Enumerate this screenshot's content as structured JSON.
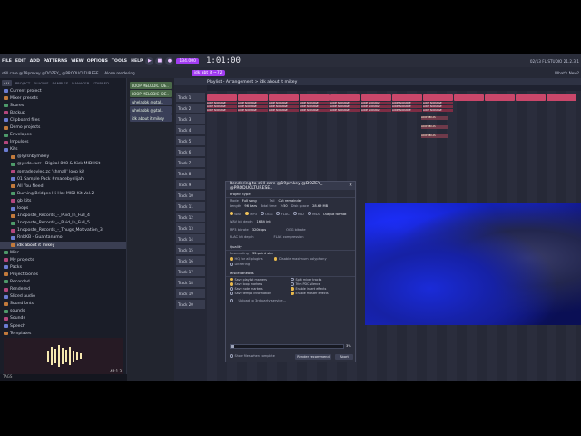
{
  "menu": [
    "FILE",
    "EDIT",
    "ADD",
    "PATTERNS",
    "VIEW",
    "OPTIONS",
    "TOOLS",
    "HELP"
  ],
  "transport": {
    "tempo": "134.000",
    "time": "1:01:00",
    "pattern": "idk abt it ~72"
  },
  "hint": {
    "line1": "still care @19pmkey @DOZEY_ @PRODUCLTURESE..",
    "line2": "Alone rendering"
  },
  "fl_version": {
    "line1": "02/13 FL STUDIO 21.2.3.1",
    "line2": "What's New?"
  },
  "browser": {
    "tabs": [
      "ALL",
      "PROJECT",
      "PLUGINS",
      "SAMPLES",
      "MANAGER",
      "STARRED"
    ],
    "items": [
      "Current project",
      "Mixer presets",
      "Scores",
      "Backup",
      "Clipboard files",
      "Demo projects",
      "Envelopes",
      "Impulses",
      "Kits",
      "@lyrsnbymikey",
      "@yedo.curr - Digital 808 & Kick MIDI Kit",
      "@madebyleo.zc 'shmall' loop kit",
      "01 Sample Pack #madebyelijah",
      "All You Need",
      "Burning Bridges Hi Hat MIDI Kit Vol.2",
      "gb kits",
      "loops",
      "1noposte_Records_-_Puid_In_Full_4",
      "1noposte_Records_-_Puid_In_Full_5",
      "1noposte_Records_-_Thugs_Motivation_3",
      "RnbKB - Guantanamo",
      "idk about it mikey",
      "Misc",
      "My projects",
      "Packs",
      "Project bones",
      "Recorded",
      "Rendered",
      "Sliced audio",
      "Soundfonts",
      "sounds",
      "Sounds",
      "Speech",
      "Templates",
      "User data"
    ],
    "footer": "TAGS"
  },
  "picker": [
    "LOOP MELODIC IDE..",
    "LOOP MELODIC IDE..",
    "whelabbk @ptal..",
    "whelabbk @ptal..",
    "idk about it mikey"
  ],
  "playlist": {
    "title": "Playlist - Arrangement > idk about it mikey",
    "tracks": [
      "Track 1",
      "Track 2",
      "Track 3",
      "Track 4",
      "Track 5",
      "Track 6",
      "Track 7",
      "Track 8",
      "Track 9",
      "Track 10",
      "Track 11",
      "Track 12",
      "Track 13",
      "Track 14",
      "Track 15",
      "Track 16",
      "Track 17",
      "Track 18",
      "Track 19",
      "Track 20"
    ],
    "clip_label": "LOOP SCOURGE",
    "small_clip_label": "LOOP 380 AS"
  },
  "render": {
    "title": "Rendering to still care @19pmkey @DOZEY_ @PRODUCLTURESE..",
    "project_type": "Project type",
    "mode_label": "Mode",
    "mode_value": "Full song",
    "tail_label": "Tail",
    "tail_value": "Cut remainder",
    "length_label": "Length",
    "length_value": "96 bars",
    "total_time_label": "Total time",
    "total_time_value": "2:50",
    "disk_space_label": "Disk space",
    "disk_space_value": "28.69 MB",
    "formats": [
      "WAV",
      "MP3",
      "OGG",
      "FLAC",
      "MID",
      "M4A"
    ],
    "output_format": "Output format",
    "bit_depth_label": "WAV bit depth",
    "bit_depth_value": "16Bit int",
    "mp3_bitrate_label": "MP3 bitrate",
    "mp3_bitrate_value": "320kbps",
    "ogg_bitrate_label": "OGG bitrate",
    "flac_bit_depth_label": "FLAC bit depth",
    "flac_compression_label": "FLAC compression",
    "quality": "Quality",
    "resampling_label": "Resampling",
    "resampling_value": "32-point sinc",
    "hq_all": "HQ for all plugins",
    "disable_max_poly": "Disable maximum polyphony",
    "dithering": "Dithering",
    "misc": "Miscellaneous",
    "misc_options": [
      "Save playlist markers",
      "Split mixer tracks",
      "Save loop markers",
      "Trim PDC silence",
      "Save note markers",
      "Enable insert effects",
      "Save tempo information",
      "Enable master effects"
    ],
    "upload": "Upload to 3rd party service...",
    "progress_pct": "3%",
    "progress_value": 0.03,
    "show_files": "Show files when complete",
    "render_button": "Render recommend",
    "abort_button": "Abort"
  },
  "preview_time": "44:1.3",
  "colors": {
    "accent": "#a13cf0",
    "clip": "#c9476a",
    "dialog_bg": "#2b2e3c"
  }
}
